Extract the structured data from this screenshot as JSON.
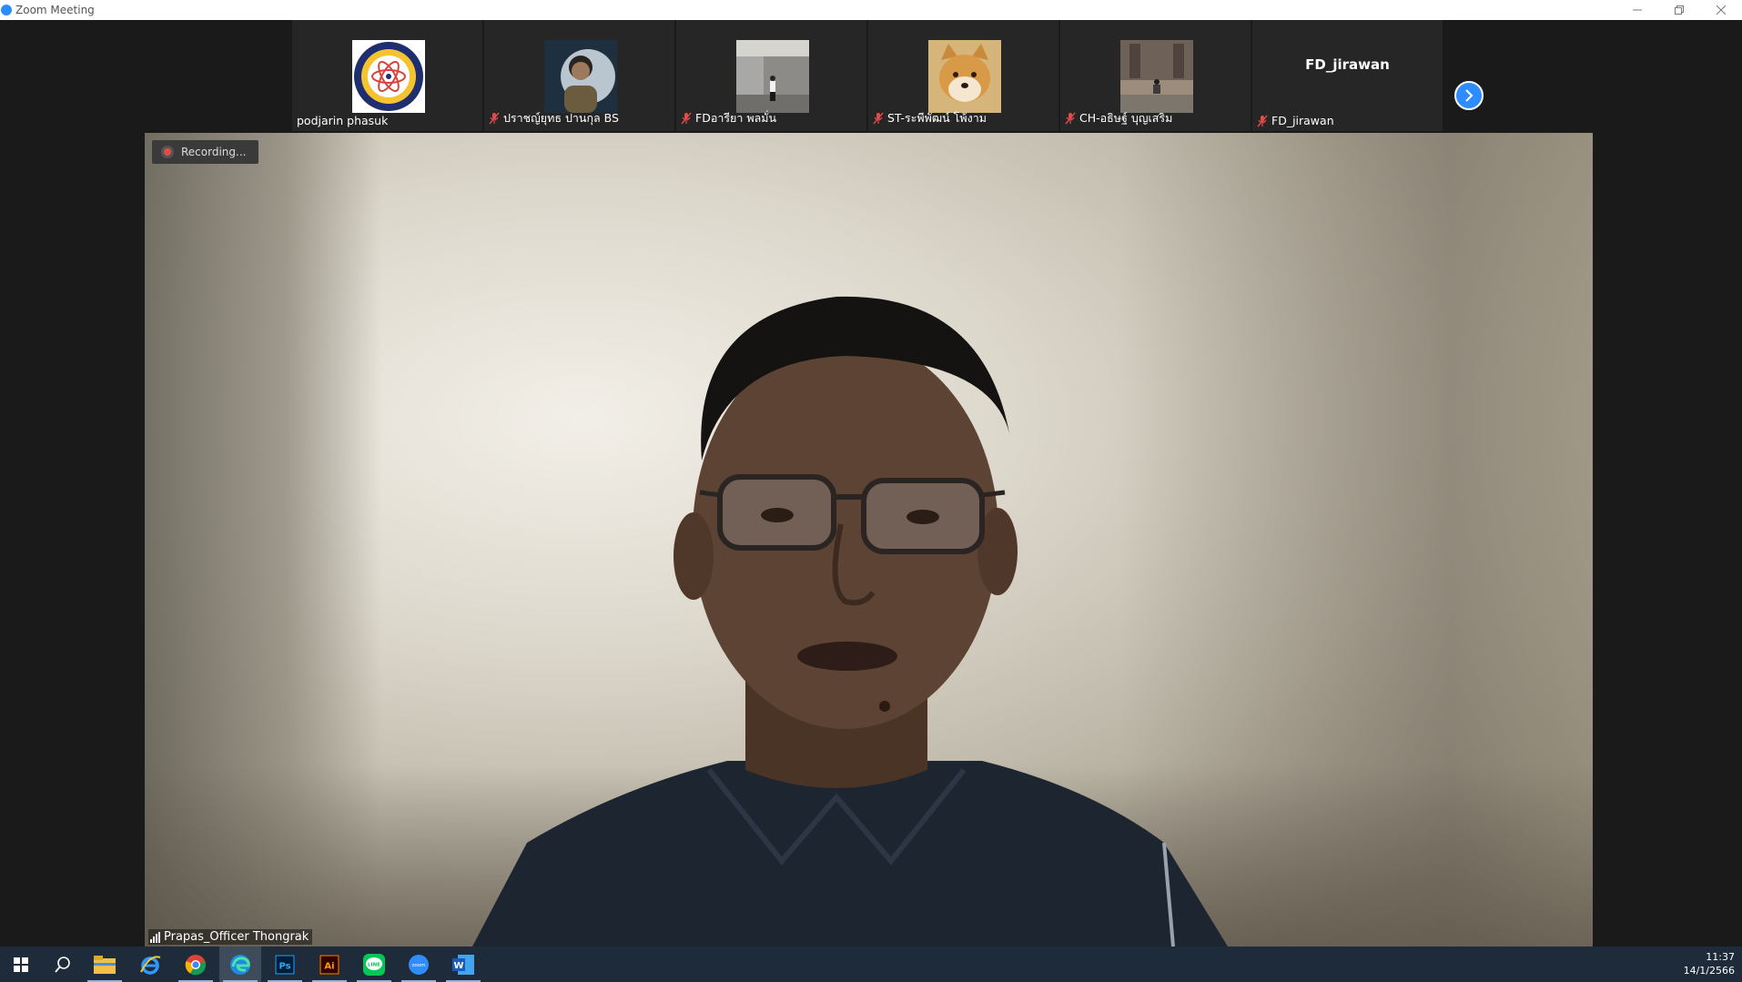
{
  "window": {
    "title": "Zoom Meeting"
  },
  "gallery": {
    "tiles": [
      {
        "name": "podjarin phasuk",
        "muted": false,
        "avatar": "school-logo"
      },
      {
        "name": "ปราชญ์ยุทธ ปานกุล BS",
        "muted": true,
        "avatar": "person-photo"
      },
      {
        "name": "FDอารียา พลมั่น",
        "muted": true,
        "avatar": "library-photo"
      },
      {
        "name": "ST-ระพีพัฒน์ โพ้งาม",
        "muted": true,
        "avatar": "dog-photo"
      },
      {
        "name": "CH-อธิษฐ์ บุญเสริม",
        "muted": true,
        "avatar": "building-photo"
      },
      {
        "name": "FD_jirawan",
        "muted": true,
        "avatar": "none",
        "display_name": "FD_jirawan"
      }
    ],
    "next_icon": "chevron-right-icon"
  },
  "main_video": {
    "recording_label": "Recording...",
    "speaker_name": "Prapas_Officer Thongrak"
  },
  "taskbar": {
    "icons": [
      "windows-start-icon",
      "search-icon",
      "file-explorer-icon",
      "internet-explorer-icon",
      "chrome-icon",
      "edge-icon",
      "photoshop-icon",
      "illustrator-icon",
      "line-icon",
      "zoom-icon",
      "word-icon"
    ],
    "photoshop_label": "Ps",
    "illustrator_label": "Ai",
    "line_label": "LINE",
    "zoom_label": "zoom",
    "word_label": "W",
    "time": "11:37",
    "date": "14/1/2566"
  },
  "colors": {
    "zoom_blue": "#2d8cff",
    "mute_red": "#e34b4b",
    "taskbar": "#1e2b3a"
  }
}
